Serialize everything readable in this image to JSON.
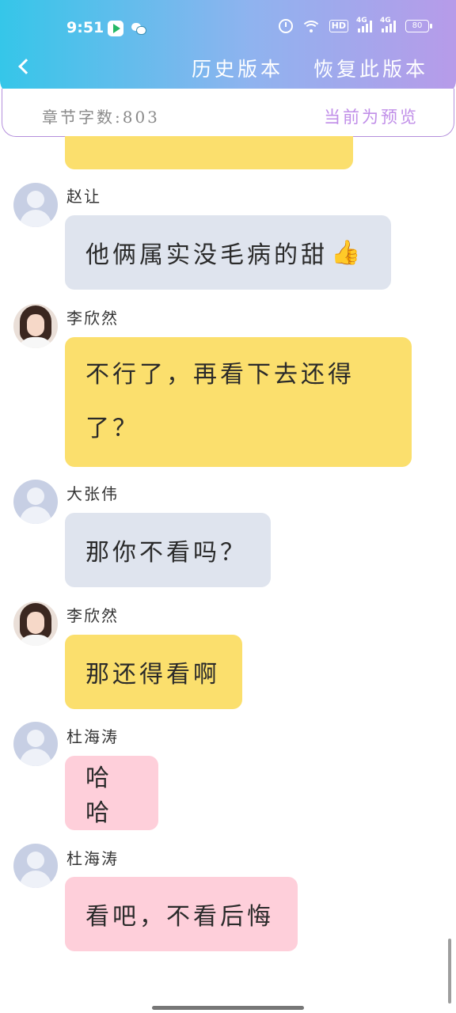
{
  "status_bar": {
    "time": "9:51",
    "hd_label": "HD",
    "network_1": "4G",
    "network_2": "4G",
    "battery": "80"
  },
  "header": {
    "history_label": "历史版本",
    "restore_label": "恢复此版本"
  },
  "infobar": {
    "word_count": "章节字数:803",
    "preview_label": "当前为预览"
  },
  "messages": [
    {
      "name": "赵让",
      "text": "他俩属实没毛病的甜",
      "emoji": "👍",
      "color": "gray",
      "avatar": "default"
    },
    {
      "name": "李欣然",
      "text_line1": "不行了，再看下去还得",
      "text_line2": "了？",
      "color": "yellow",
      "avatar": "photo"
    },
    {
      "name": "大张伟",
      "text": "那你不看吗？",
      "color": "gray",
      "avatar": "default"
    },
    {
      "name": "李欣然",
      "text": "那还得看啊",
      "color": "yellow",
      "avatar": "photo"
    },
    {
      "name": "杜海涛",
      "text": "哈哈",
      "color": "pink",
      "avatar": "default"
    },
    {
      "name": "杜海涛",
      "text": "看吧，不看后悔",
      "color": "pink",
      "avatar": "default"
    }
  ],
  "colors": {
    "yellow_bubble": "#fbdf6d",
    "gray_bubble": "#dfe4ee",
    "pink_bubble": "#fecfda",
    "accent_purple": "#c08ee8"
  }
}
